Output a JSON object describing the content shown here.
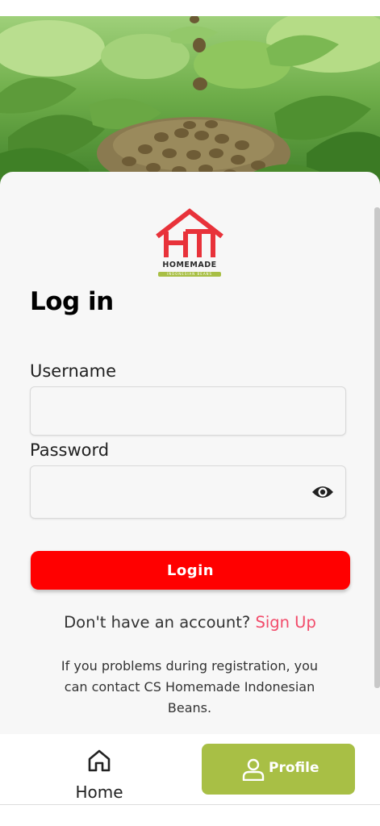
{
  "brand": {
    "logo_word": "HOMEMADE",
    "logo_tagline": "INDONESIAN BEANS",
    "logo_color": "#e8323a",
    "accent_green": "#a8bf45"
  },
  "login": {
    "title": "Log in",
    "username_label": "Username",
    "username_value": "",
    "password_label": "Password",
    "password_value": "",
    "password_icon": "eye-icon",
    "submit_label": "Login",
    "submit_color": "#ff0000",
    "signup_prompt": "Don't have an account?",
    "signup_link": "Sign Up",
    "signup_color": "#f24b6a",
    "help_text": "If you problems during registration, you can contact CS Homemade Indonesian Beans."
  },
  "bottom_nav": {
    "items": [
      {
        "label": "Home",
        "icon": "home-icon",
        "active": false
      },
      {
        "label": "Profile",
        "icon": "user-icon",
        "active": true
      }
    ]
  }
}
